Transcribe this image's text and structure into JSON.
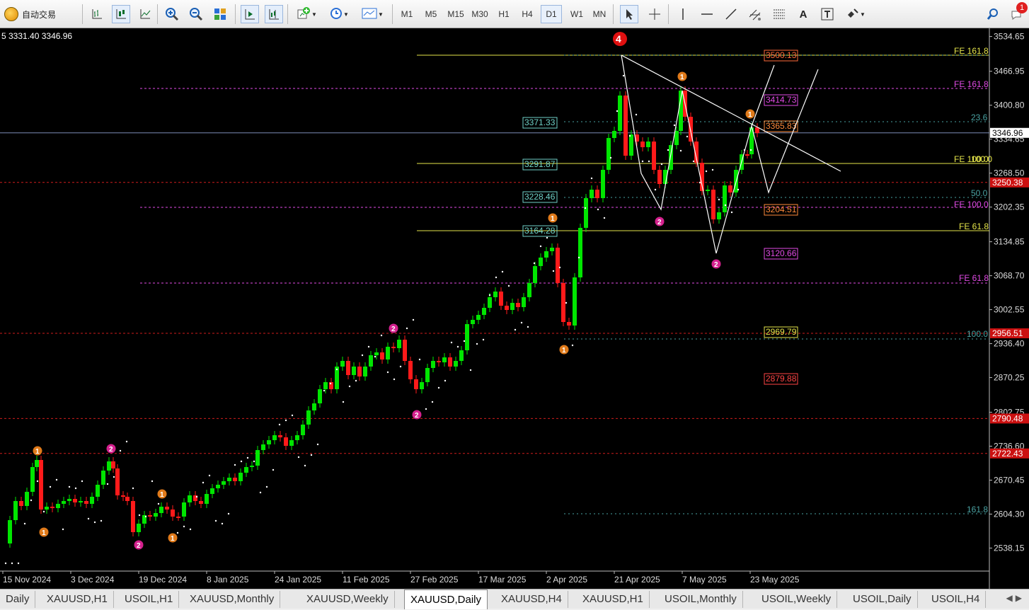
{
  "toolbar": {
    "auto_trade_label": "自动交易",
    "timeframes": [
      "M1",
      "M5",
      "M15",
      "M30",
      "H1",
      "H4",
      "D1",
      "W1",
      "MN"
    ],
    "active_timeframe": "D1",
    "notification_count": "1"
  },
  "chart": {
    "ohlc_text": "5 3331.40 3346.96",
    "wave_top_label": "4",
    "current_price": "3346.96",
    "price_axis": [
      "3534.65",
      "3466.95",
      "3400.80",
      "3334.65",
      "3268.50",
      "3202.35",
      "3134.85",
      "3068.70",
      "3002.55",
      "2936.40",
      "2870.25",
      "2802.75",
      "2736.60",
      "2670.45",
      "2604.30",
      "2538.15"
    ],
    "red_axis_labels": [
      "3250.38",
      "2956.51",
      "2790.48",
      "2722.43"
    ],
    "date_axis": [
      "15 Nov 2024",
      "3 Dec 2024",
      "19 Dec 2024",
      "8 Jan 2025",
      "24 Jan 2025",
      "11 Feb 2025",
      "27 Feb 2025",
      "17 Mar 2025",
      "2 Apr 2025",
      "21 Apr 2025",
      "7 May 2025",
      "23 May 2025"
    ],
    "left_price_tags": [
      "3371.33",
      "3291.87",
      "3228.46",
      "3164.28"
    ],
    "right_price_tags": [
      "3500.13",
      "3414.73",
      "3365.83",
      "3204.51",
      "3120.66",
      "2969.79",
      "2879.88"
    ],
    "fib_labels": [
      "FE 161.8",
      "FE 161.8",
      "23.6",
      "FE 100.0",
      "100.0",
      "50.0",
      "FE 100.0",
      "FE 61.8",
      "FE 61.8",
      "100.0",
      "161.8"
    ],
    "wave_labels": [
      "1",
      "1",
      "1",
      "1",
      "2",
      "1",
      "2",
      "2",
      "1",
      "1",
      "2",
      "2",
      "1",
      "2"
    ]
  },
  "tabs": [
    "Daily",
    "XAUUSD,H1",
    "USOIL,H1",
    "XAUUSD,Monthly",
    "XAUUSD,Weekly",
    "XAUUSD,Daily",
    "XAUUSD,H4",
    "XAUUSD,H1",
    "USOIL,Monthly",
    "USOIL,Weekly",
    "USOIL,Daily",
    "USOIL,H4"
  ],
  "active_tab": "XAUUSD,Daily",
  "colors": {
    "bull": "#00e600",
    "bear": "#ff1a1a",
    "fib_yellow": "#e5e54a",
    "fe_magenta": "#e24be6",
    "red_level": "#d01c1c",
    "background": "#000000"
  }
}
